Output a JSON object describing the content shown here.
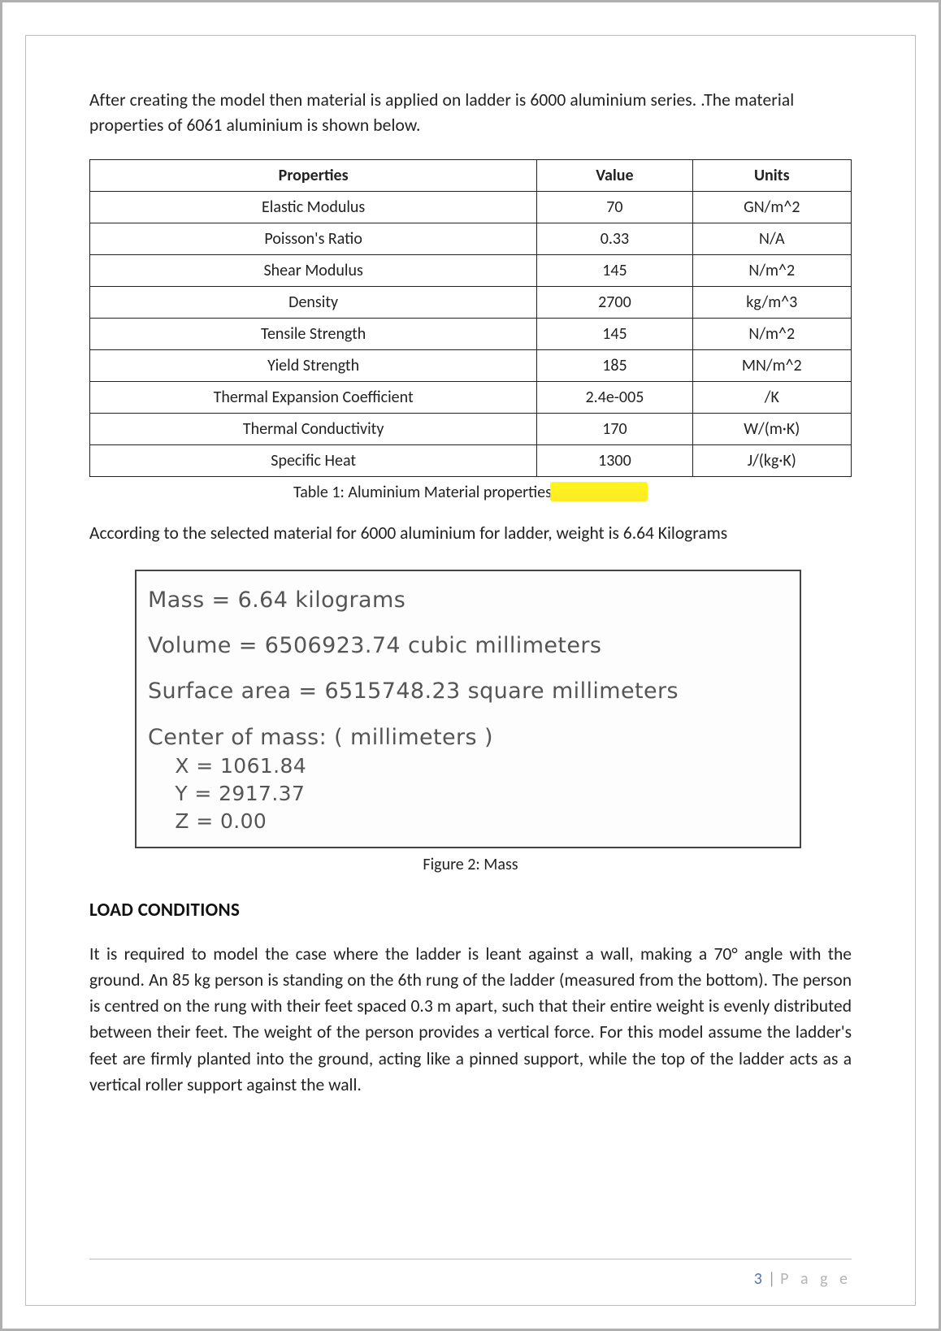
{
  "intro": "After creating the model then material is applied on ladder is 6000 aluminium series. .The material properties of 6061 aluminium is shown below.",
  "table": {
    "headers": {
      "c1": "Properties",
      "c2": "Value",
      "c3": "Units"
    },
    "rows": [
      {
        "prop": "Elastic Modulus",
        "value": "70",
        "units": "GN/m^2"
      },
      {
        "prop": "Poisson's Ratio",
        "value": "0.33",
        "units": "N/A"
      },
      {
        "prop": "Shear Modulus",
        "value": "145",
        "units": "N/m^2"
      },
      {
        "prop": "Density",
        "value": "2700",
        "units": "kg/m^3"
      },
      {
        "prop": "Tensile Strength",
        "value": "145",
        "units": "N/m^2"
      },
      {
        "prop": "Yield Strength",
        "value": "185",
        "units": "MN/m^2"
      },
      {
        "prop": "Thermal Expansion Coefficient",
        "value": "2.4e-005",
        "units": "/K"
      },
      {
        "prop": "Thermal Conductivity",
        "value": "170",
        "units": "W/(m·K)"
      },
      {
        "prop": "Specific Heat",
        "value": "1300",
        "units": "J/(kg·K)"
      }
    ]
  },
  "table_caption": "Table 1: Aluminium Material properties",
  "weight_paragraph": "According to the selected material for 6000 aluminium for ladder, weight is 6.64 Kilograms",
  "figure": {
    "mass_line": "Mass = 6.64 kilograms",
    "volume_line": "Volume = 6506923.74 cubic millimeters",
    "surface_area_line": "Surface area = 6515748.23 square millimeters",
    "com_header": "Center of mass: ( millimeters )",
    "com_x": "    X = 1061.84",
    "com_y": "    Y = 2917.37",
    "com_z": "    Z = 0.00"
  },
  "figure_caption": "Figure 2: Mass",
  "section_heading": "LOAD CONDITIONS",
  "load_paragraph": "It is required to model the case where the ladder is leant against a wall, making a 70° angle with the ground. An 85 kg person is standing on the 6th rung of the ladder (measured from the bottom). The person is centred on the rung with their feet spaced 0.3 m apart, such that their entire weight is evenly distributed between their feet. The weight of the person provides a vertical force. For this model assume the ladder's feet are firmly planted into the ground, acting like a pinned support, while the top of the ladder acts as a vertical roller support against the wall.",
  "footer": {
    "page_number": "3",
    "page_word": "P a g e"
  }
}
